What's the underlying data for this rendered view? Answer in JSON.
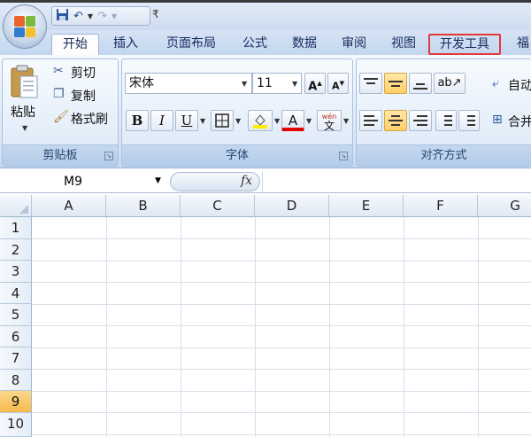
{
  "qat": {
    "customize": "₹"
  },
  "tabs": [
    "开始",
    "插入",
    "页面布局",
    "公式",
    "数据",
    "审阅",
    "视图",
    "开发工具",
    "福"
  ],
  "clipboard": {
    "paste": "粘贴",
    "cut": "剪切",
    "copy": "复制",
    "format_painter": "格式刷",
    "label": "剪贴板"
  },
  "font": {
    "name": "宋体",
    "size": "11",
    "bold": "B",
    "italic": "I",
    "underline": "U",
    "font_color": "A",
    "phonetic": "wén",
    "phonetic_char": "文",
    "label": "字体"
  },
  "alignment": {
    "wrap": "自动",
    "merge": "合并",
    "label": "对齐方式"
  },
  "formula_bar": {
    "name_box": "M9",
    "fx": "fx",
    "content": ""
  },
  "sheet": {
    "columns": [
      "A",
      "B",
      "C",
      "D",
      "E",
      "F",
      "G"
    ],
    "rows": [
      "1",
      "2",
      "3",
      "4",
      "5",
      "6",
      "7",
      "8",
      "9",
      "10"
    ],
    "selected_row": "9"
  },
  "colors": {
    "active_tab_border": "#e03a3a",
    "selected_header": "#f7b94b"
  }
}
